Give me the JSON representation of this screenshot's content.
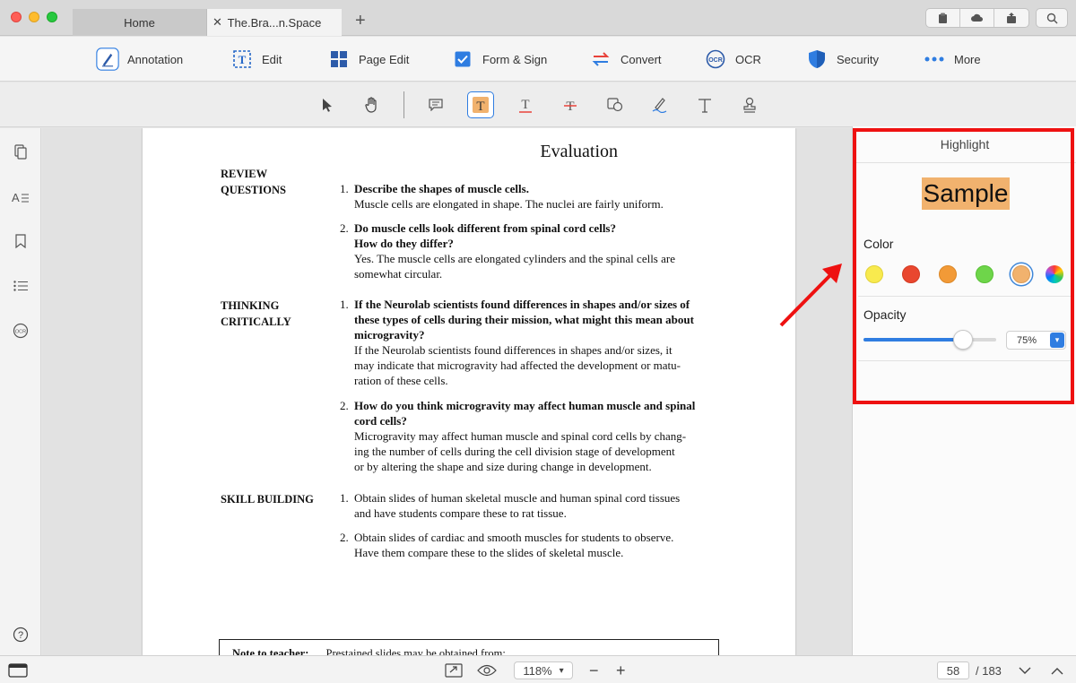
{
  "tabs": [
    {
      "label": "Home"
    },
    {
      "label": "The.Bra...n.Space"
    }
  ],
  "main_toolbar": [
    {
      "label": "Annotation",
      "icon": "annotation-icon"
    },
    {
      "label": "Edit",
      "icon": "edit-icon"
    },
    {
      "label": "Page Edit",
      "icon": "page-edit-icon"
    },
    {
      "label": "Form & Sign",
      "icon": "form-sign-icon"
    },
    {
      "label": "Convert",
      "icon": "convert-icon"
    },
    {
      "label": "OCR",
      "icon": "ocr-icon"
    },
    {
      "label": "Security",
      "icon": "shield-icon"
    },
    {
      "label": "More",
      "icon": "more-icon"
    }
  ],
  "ocr_icon_text": "OCR",
  "document": {
    "title": "Evaluation",
    "sections": [
      {
        "label": "REVIEW\nQUESTIONS"
      },
      {
        "label": "THINKING\nCRITICALLY"
      },
      {
        "label": "SKILL BUILDING"
      }
    ],
    "questions": [
      {
        "num": "1.",
        "q": "Describe the shapes of muscle cells.",
        "a": "Muscle cells are elongated in shape. The nuclei are fairly uniform."
      },
      {
        "num": "2.",
        "q": "Do muscle cells look different from spinal cord cells?\nHow do they differ?",
        "a": "Yes. The muscle cells are elongated cylinders and the spinal cells are\nsomewhat circular."
      },
      {
        "num": "1.",
        "q": "If the Neurolab scientists found differences in shapes and/or sizes of\nthese types of cells during their mission, what might this mean about\nmicrogravity?",
        "a": "If the Neurolab scientists found differences in shapes and/or sizes, it\nmay indicate that microgravity had affected the development or matu-\nration of these cells."
      },
      {
        "num": "2.",
        "q": "How do you think microgravity may affect human muscle and spinal\ncord cells?",
        "a": "Microgravity may affect human muscle and spinal cord cells by chang-\ning the number of cells during the cell division stage of development\nor by altering the shape and size during change in development."
      },
      {
        "num": "1.",
        "q": "",
        "a": "Obtain slides of human skeletal muscle and human spinal cord tissues\nand have students compare these to rat tissue."
      },
      {
        "num": "2.",
        "q": "",
        "a": "Obtain slides of cardiac and smooth muscles for students to observe.\nHave them compare these to the slides of skeletal muscle."
      }
    ],
    "note_label": "Note to teacher:",
    "note_text": "Prestained slides may be obtained from:"
  },
  "highlight_panel": {
    "title": "Highlight",
    "sample_text": "Sample",
    "color_label": "Color",
    "colors": [
      "#f8ea4e",
      "#e9472f",
      "#f29a37",
      "#6ed54a",
      "#f1b26e"
    ],
    "selected_color": "#f1b26e",
    "opacity_label": "Opacity",
    "opacity_value": "75%",
    "opacity_fraction": 0.75
  },
  "bottom": {
    "zoom": "118%",
    "page_current": "58",
    "page_total": "/ 183"
  }
}
